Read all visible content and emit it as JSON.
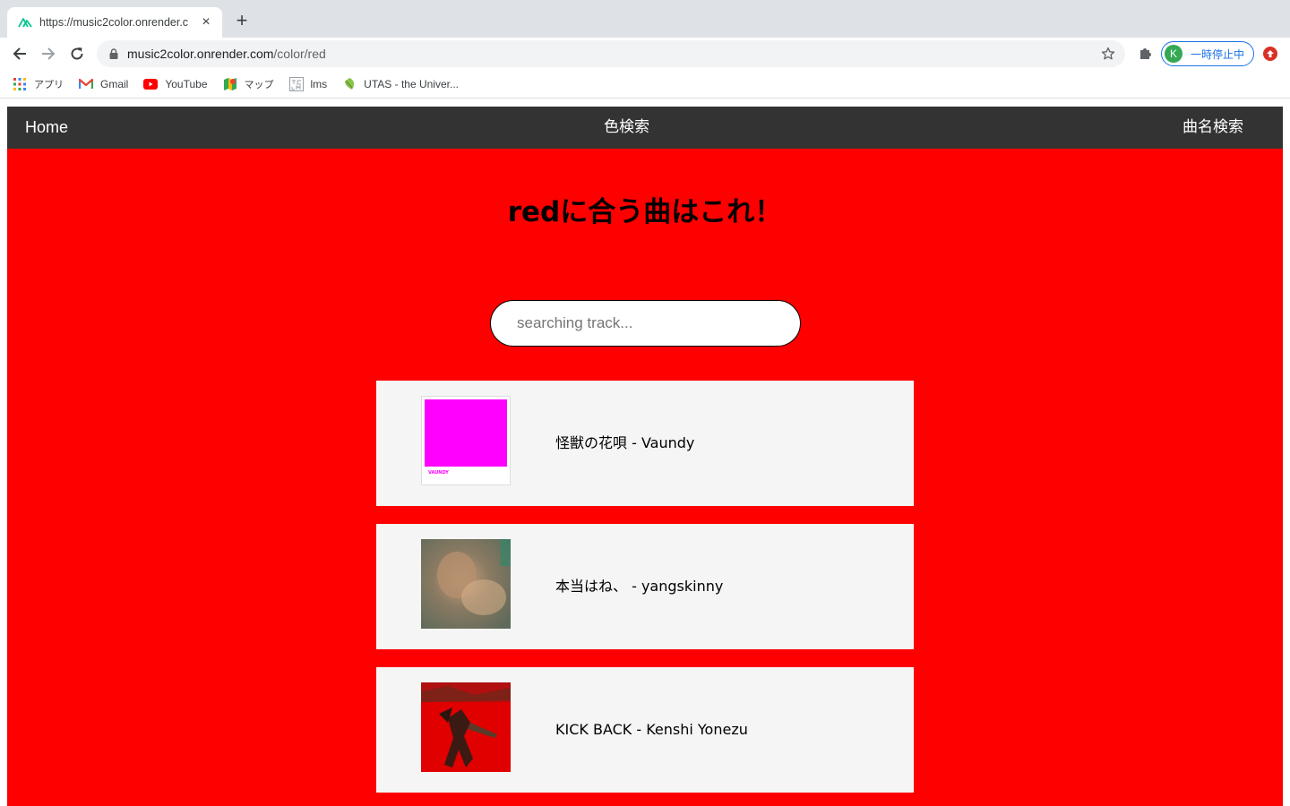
{
  "browser": {
    "tab_title": "https://music2color.onrender.c",
    "url_host": "music2color.onrender.com",
    "url_path": "/color/red",
    "profile_initial": "K",
    "profile_label": "一時停止中",
    "bookmarks": [
      {
        "label": "アプリ",
        "icon": "apps-grid-icon"
      },
      {
        "label": "Gmail",
        "icon": "gmail-icon"
      },
      {
        "label": "YouTube",
        "icon": "youtube-icon"
      },
      {
        "label": "マップ",
        "icon": "maps-icon"
      },
      {
        "label": "lms",
        "icon": "lms-icon"
      },
      {
        "label": "UTAS - the Univer...",
        "icon": "utas-icon"
      }
    ]
  },
  "navbar": {
    "home": "Home",
    "color_search": "色検索",
    "title_search": "曲名検索"
  },
  "page": {
    "heading": "redに合う曲はこれ！",
    "search_placeholder": "searching track...",
    "theme_color": "#ff0000"
  },
  "tracks": [
    {
      "label": "怪獣の花唄 - Vaundy",
      "cover_text": "VAUNDY"
    },
    {
      "label": "本当はね、 - yangskinny"
    },
    {
      "label": "KICK BACK - Kenshi Yonezu"
    }
  ]
}
